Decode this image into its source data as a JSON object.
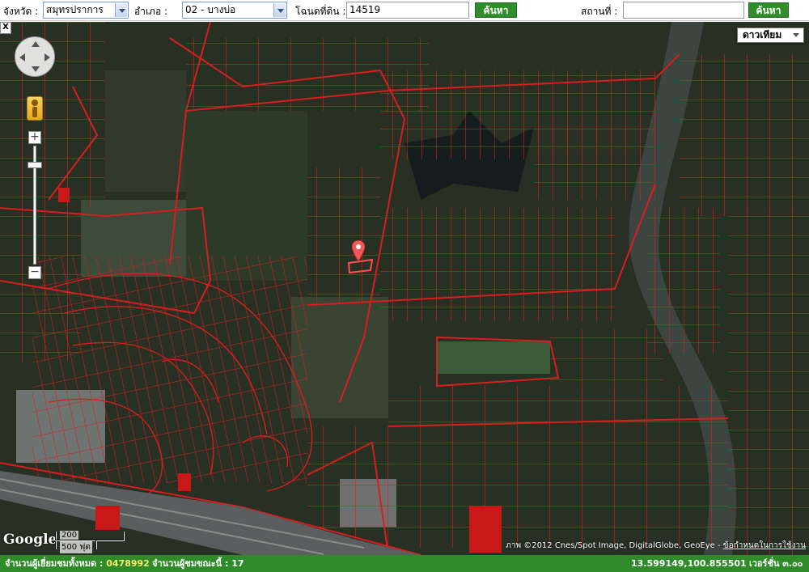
{
  "search": {
    "province_label": "จังหวัด :",
    "province_value": "สมุทรปราการ",
    "district_label": "อำเภอ :",
    "district_value": "02 - บางบ่อ",
    "deed_label": "โฉนดที่ดิน :",
    "deed_value": "14519",
    "search_button": "ค้นหา",
    "place_label": "สถานที่ :",
    "place_value": "",
    "place_search_button": "ค้นหา"
  },
  "map": {
    "collapse_label": "X",
    "map_type": "ดาวเทียม",
    "zoom_plus": "+",
    "zoom_minus": "−",
    "logo": "Google",
    "scale_top": "200 ",
    "scale_bottom": "500 ฟุต",
    "copyright": "ภาพ ©2012 Cnes/Spot Image, DigitalGlobe, GeoEye - ",
    "terms": "ข้อกำหนดในการใช้งาน",
    "parcel_color": "#d81e1e",
    "icons": [
      "pan-control-icon",
      "pegman-icon",
      "map-marker-icon",
      "google-logo"
    ]
  },
  "status": {
    "total_label": "จำนวนผู้เยี่ยมชมทั้งหมด : ",
    "total_value": "0478992",
    "current_label": "จำนวนผู้ชมขณะนี้ : ",
    "current_value": "17",
    "coordinates": "13.599149,100.855501",
    "version": "เวอร์ชั่น ๓.๐๐"
  }
}
